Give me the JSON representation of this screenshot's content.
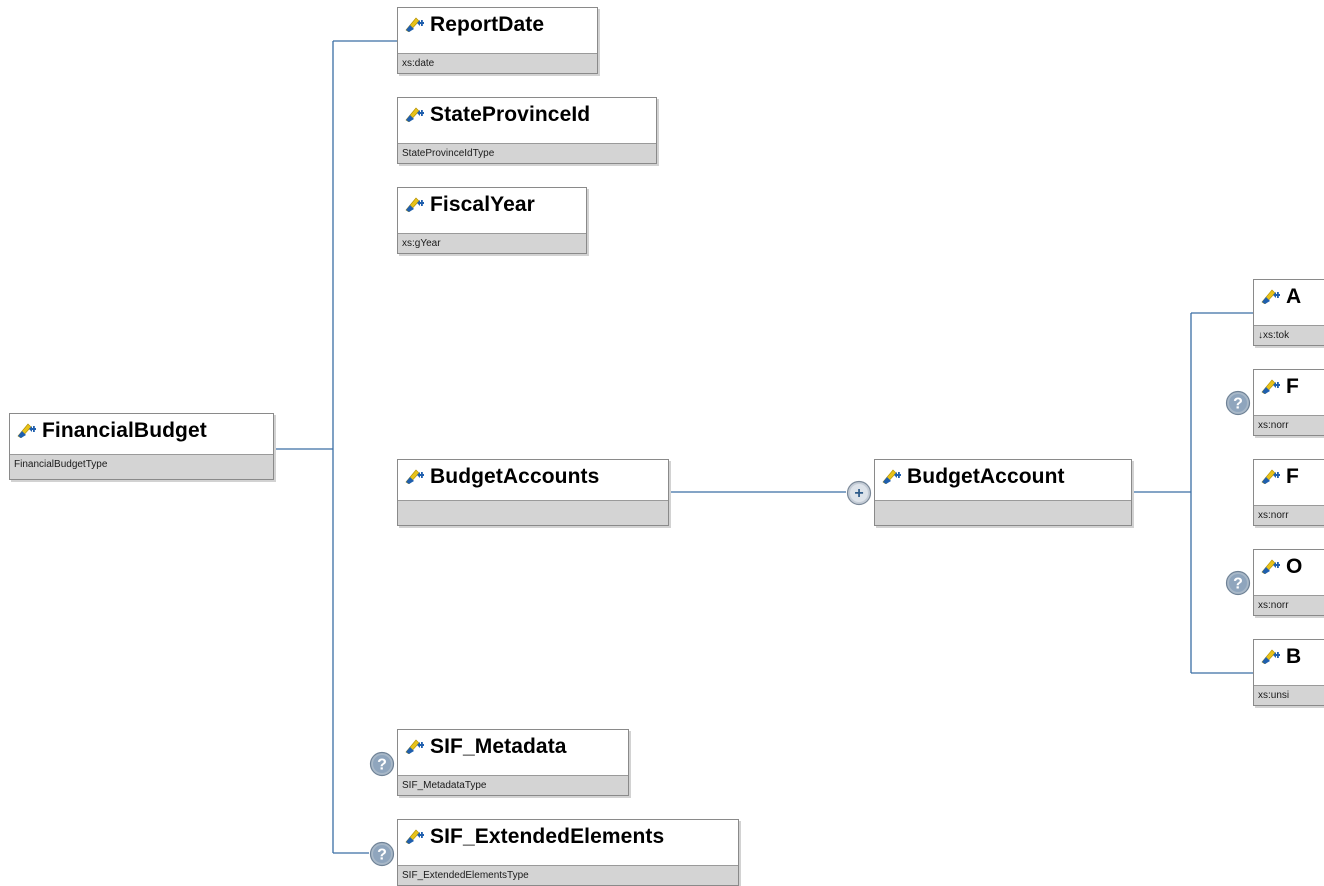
{
  "colors": {
    "connector": "#3a6ea5",
    "node_border": "#8a8a8a",
    "footer_bg": "#d4d4d4",
    "badge": "#8fa5bd"
  },
  "icons": {
    "element": "element-pencil-icon",
    "optional": "question-mark-icon",
    "expand": "plus-icon"
  },
  "root": {
    "name": "FinancialBudget",
    "type": "FinancialBudgetType"
  },
  "children": [
    {
      "name": "ReportDate",
      "type": "xs:date"
    },
    {
      "name": "StateProvinceId",
      "type": "StateProvinceIdType"
    },
    {
      "name": "FiscalYear",
      "type": "xs:gYear"
    },
    {
      "name": "BudgetAccounts",
      "type": ""
    },
    {
      "name": "SIF_Metadata",
      "type": "SIF_MetadataType"
    },
    {
      "name": "SIF_ExtendedElements",
      "type": "SIF_ExtendedElementsType"
    }
  ],
  "budget_account": {
    "name": "BudgetAccount",
    "type": ""
  },
  "account_children": [
    {
      "name": "A",
      "type": "↓xs:tok"
    },
    {
      "name": "F",
      "type": "xs:norr"
    },
    {
      "name": "F",
      "type": "xs:norr"
    },
    {
      "name": "O",
      "type": "xs:norr"
    },
    {
      "name": "B",
      "type": "xs:unsi"
    }
  ],
  "glyphs": {
    "optional": "?",
    "expand": "+"
  }
}
